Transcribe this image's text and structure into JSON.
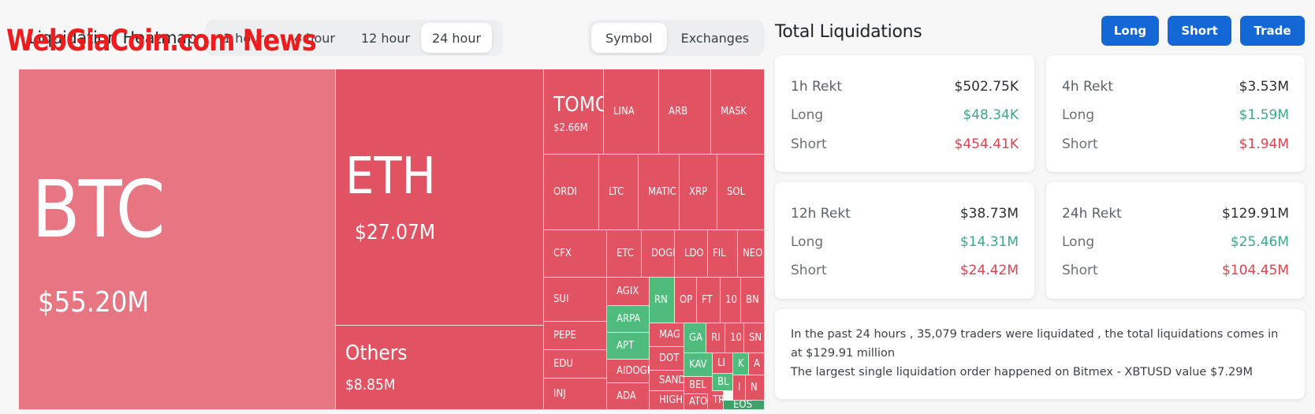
{
  "watermark": "WebGiaCoin.com News",
  "heatmap": {
    "title": "Liquidation Heatmap",
    "time_options": [
      {
        "label": "1 hour",
        "active": false
      },
      {
        "label": "4 hour",
        "active": false
      },
      {
        "label": "12 hour",
        "active": false
      },
      {
        "label": "24 hour",
        "active": true
      }
    ],
    "view_options": [
      {
        "label": "Symbol",
        "active": true
      },
      {
        "label": "Exchanges",
        "active": false
      }
    ]
  },
  "treemap": {
    "btc": {
      "symbol": "BTC",
      "value": "$55.20M"
    },
    "eth": {
      "symbol": "ETH",
      "value": "$27.07M"
    },
    "others": {
      "symbol": "Others",
      "value": "$8.85M"
    },
    "tomo": {
      "symbol": "TOMO",
      "value": "$2.66M"
    },
    "cells": [
      {
        "symbol": "LINA",
        "color": "red"
      },
      {
        "symbol": "ARB",
        "color": "red"
      },
      {
        "symbol": "MASK",
        "color": "red"
      },
      {
        "symbol": "ORDI",
        "color": "red"
      },
      {
        "symbol": "LTC",
        "color": "red"
      },
      {
        "symbol": "MATIC",
        "color": "red"
      },
      {
        "symbol": "XRP",
        "color": "red"
      },
      {
        "symbol": "SOL",
        "color": "red"
      },
      {
        "symbol": "CFX",
        "color": "red"
      },
      {
        "symbol": "ETC",
        "color": "red"
      },
      {
        "symbol": "DOGE",
        "color": "red"
      },
      {
        "symbol": "LDO",
        "color": "red"
      },
      {
        "symbol": "FIL",
        "color": "red"
      },
      {
        "symbol": "NEO",
        "color": "red"
      },
      {
        "symbol": "SUI",
        "color": "red"
      },
      {
        "symbol": "AGIX",
        "color": "red"
      },
      {
        "symbol": "RN",
        "color": "green"
      },
      {
        "symbol": "OP",
        "color": "red"
      },
      {
        "symbol": "FT",
        "color": "red"
      },
      {
        "symbol": "10",
        "color": "red"
      },
      {
        "symbol": "BN",
        "color": "red"
      },
      {
        "symbol": "PEPE",
        "color": "red"
      },
      {
        "symbol": "ARPA",
        "color": "green"
      },
      {
        "symbol": "APT",
        "color": "green"
      },
      {
        "symbol": "MAG",
        "color": "red"
      },
      {
        "symbol": "GA",
        "color": "green"
      },
      {
        "symbol": "RI",
        "color": "red"
      },
      {
        "symbol": "10",
        "color": "red"
      },
      {
        "symbol": "SN",
        "color": "red"
      },
      {
        "symbol": "EDU",
        "color": "red"
      },
      {
        "symbol": "AIDOGE",
        "color": "red"
      },
      {
        "symbol": "DOT",
        "color": "red"
      },
      {
        "symbol": "KAV",
        "color": "green"
      },
      {
        "symbol": "LI",
        "color": "red"
      },
      {
        "symbol": "K",
        "color": "green"
      },
      {
        "symbol": "A",
        "color": "red"
      },
      {
        "symbol": "INJ",
        "color": "red"
      },
      {
        "symbol": "ADA",
        "color": "red"
      },
      {
        "symbol": "SAND",
        "color": "red"
      },
      {
        "symbol": "BEL",
        "color": "red"
      },
      {
        "symbol": "BL",
        "color": "green"
      },
      {
        "symbol": "I",
        "color": "red"
      },
      {
        "symbol": "N",
        "color": "red"
      },
      {
        "symbol": "HIGH",
        "color": "red"
      },
      {
        "symbol": "ATO",
        "color": "red"
      },
      {
        "symbol": "TR",
        "color": "red"
      },
      {
        "symbol": "EOS",
        "color": "darkgreen"
      }
    ]
  },
  "total": {
    "title": "Total Liquidations",
    "buttons": {
      "long": "Long",
      "short": "Short",
      "trade": "Trade"
    },
    "cards": [
      {
        "label": "1h Rekt",
        "total": "$502.75K",
        "long_label": "Long",
        "long": "$48.34K",
        "short_label": "Short",
        "short": "$454.41K"
      },
      {
        "label": "4h Rekt",
        "total": "$3.53M",
        "long_label": "Long",
        "long": "$1.59M",
        "short_label": "Short",
        "short": "$1.94M"
      },
      {
        "label": "12h Rekt",
        "total": "$38.73M",
        "long_label": "Long",
        "long": "$14.31M",
        "short_label": "Short",
        "short": "$24.42M"
      },
      {
        "label": "24h Rekt",
        "total": "$129.91M",
        "long_label": "Long",
        "long": "$25.46M",
        "short_label": "Short",
        "short": "$104.45M"
      }
    ],
    "summary_line1": "In the past 24 hours , 35,079 traders were liquidated , the total liquidations comes in at $129.91 million",
    "summary_line2": "The largest single liquidation order happened on Bitmex - XBTUSD value $7.29M"
  }
}
